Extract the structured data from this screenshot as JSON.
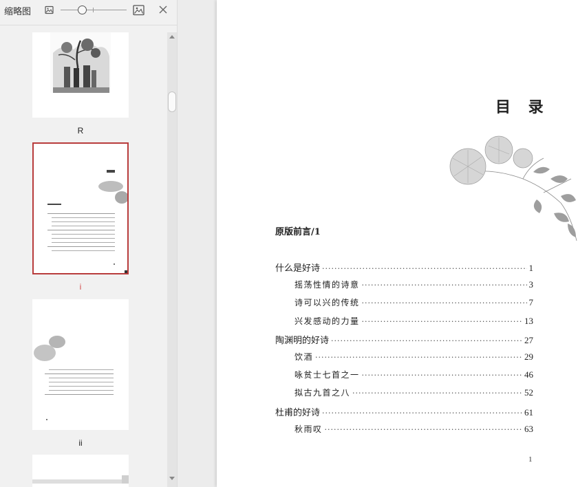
{
  "sidebar": {
    "title": "缩略图",
    "zoom": {
      "level": 0.3
    },
    "thumbnails": [
      {
        "label": "R",
        "selected": false
      },
      {
        "label": "i",
        "selected": true
      },
      {
        "label": "ii",
        "selected": false
      }
    ]
  },
  "page": {
    "title": "目 录",
    "preface": "原版前言/1",
    "page_number": "1",
    "toc": [
      {
        "title": "什么是好诗",
        "page": "1",
        "level": 1
      },
      {
        "title": "摇荡性情的诗意",
        "page": "3",
        "level": 2
      },
      {
        "title": "诗可以兴的传统",
        "page": "7",
        "level": 2
      },
      {
        "title": "兴发感动的力量",
        "page": "13",
        "level": 2
      },
      {
        "title": "陶渊明的好诗",
        "page": "27",
        "level": 1
      },
      {
        "title": "饮酒",
        "page": "29",
        "level": 2
      },
      {
        "title": "咏贫士七首之一",
        "page": "46",
        "level": 2
      },
      {
        "title": "拟古九首之八",
        "page": "52",
        "level": 2
      },
      {
        "title": "杜甫的好诗",
        "page": "61",
        "level": 1
      },
      {
        "title": "秋雨叹",
        "page": "63",
        "level": 2
      }
    ]
  },
  "colors": {
    "selected_border": "#b83b3b",
    "selected_label": "#d24a4a"
  }
}
